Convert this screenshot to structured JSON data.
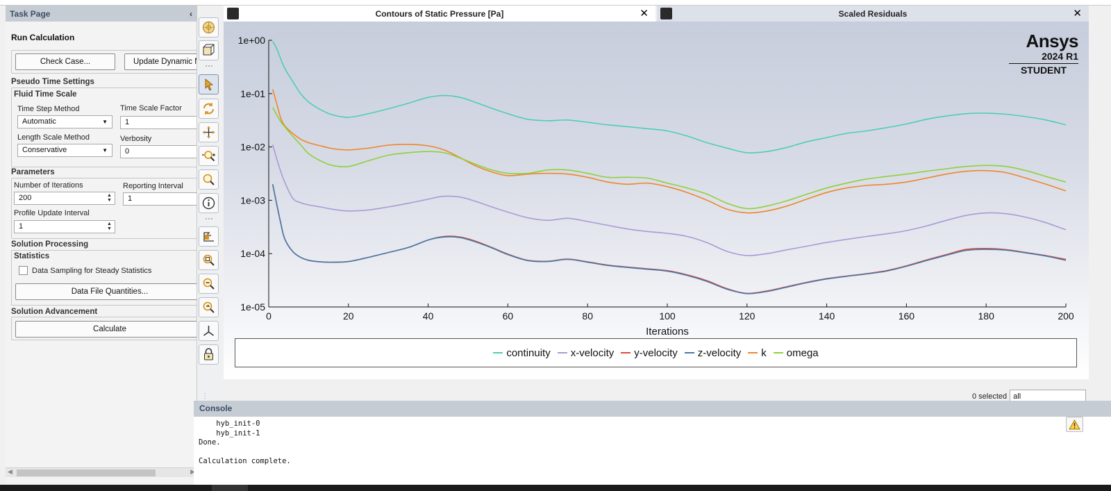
{
  "task_page": {
    "header": "Task Page",
    "collapse_glyph": "‹",
    "title": "Run Calculation",
    "check_case_label": "Check Case...",
    "update_dynamic_label": "Update Dynamic Mesh...",
    "pseudo_time_settings": "Pseudo Time Settings",
    "fluid_time_scale": "Fluid Time Scale",
    "time_step_method_label": "Time Step Method",
    "time_step_method_value": "Automatic",
    "time_scale_factor_label": "Time Scale Factor",
    "time_scale_factor_value": "1",
    "length_scale_method_label": "Length Scale Method",
    "length_scale_method_value": "Conservative",
    "verbosity_label": "Verbosity",
    "verbosity_value": "0",
    "parameters": "Parameters",
    "num_iterations_label": "Number of Iterations",
    "num_iterations_value": "200",
    "reporting_interval_label": "Reporting Interval",
    "reporting_interval_value": "1",
    "profile_update_label": "Profile Update Interval",
    "profile_update_value": "1",
    "solution_processing": "Solution Processing",
    "statistics": "Statistics",
    "data_sampling_label": "Data Sampling for Steady Statistics",
    "data_file_quantities_label": "Data File Quantities...",
    "solution_advancement": "Solution Advancement",
    "calculate_label": "Calculate"
  },
  "tabs": {
    "contours_title": "Contours of Static Pressure [Pa]",
    "residuals_title": "Scaled Residuals",
    "close_glyph": "✕"
  },
  "logo": {
    "name": "Ansys",
    "version": "2024 R1",
    "edition": "STUDENT"
  },
  "status": {
    "selected_count": "0 selected",
    "filter_value": "all"
  },
  "console": {
    "header": "Console",
    "text": "    hyb_init-0\n    hyb_init-1\nDone.\n\nCalculation complete."
  },
  "colors": {
    "continuity": "#4ecdb6",
    "x-velocity": "#a99ad6",
    "y-velocity": "#e0493a",
    "z-velocity": "#4478a8",
    "k": "#f0852a",
    "omega": "#8fd03a"
  },
  "chart_data": {
    "type": "line",
    "title": "",
    "xlabel": "Iterations",
    "ylabel": "",
    "xlim": [
      0,
      200
    ],
    "ylim": [
      1e-05,
      1
    ],
    "yscale": "log",
    "x_ticks": [
      "0",
      "20",
      "40",
      "60",
      "80",
      "100",
      "120",
      "140",
      "160",
      "180",
      "200"
    ],
    "y_ticks": [
      "1e+00",
      "1e-01",
      "1e-02",
      "1e-03",
      "1e-04",
      "1e-05"
    ],
    "legend_position": "bottom",
    "x": [
      1,
      2,
      3,
      4,
      6,
      8,
      10,
      13,
      16,
      20,
      25,
      30,
      35,
      40,
      44,
      48,
      52,
      56,
      60,
      65,
      70,
      75,
      80,
      85,
      90,
      95,
      100,
      105,
      110,
      115,
      120,
      125,
      130,
      135,
      140,
      145,
      150,
      155,
      160,
      165,
      170,
      175,
      180,
      185,
      190,
      195,
      200
    ],
    "series": [
      {
        "name": "continuity",
        "values": [
          0.95,
          0.7,
          0.45,
          0.3,
          0.17,
          0.1,
          0.07,
          0.05,
          0.04,
          0.036,
          0.042,
          0.052,
          0.066,
          0.085,
          0.092,
          0.085,
          0.068,
          0.053,
          0.042,
          0.033,
          0.031,
          0.032,
          0.029,
          0.026,
          0.024,
          0.022,
          0.02,
          0.016,
          0.012,
          0.0095,
          0.0078,
          0.0082,
          0.0098,
          0.0125,
          0.015,
          0.018,
          0.02,
          0.023,
          0.027,
          0.033,
          0.038,
          0.042,
          0.043,
          0.041,
          0.037,
          0.032,
          0.026
        ]
      },
      {
        "name": "x-velocity",
        "values": [
          0.011,
          0.006,
          0.0035,
          0.0022,
          0.0011,
          0.0009,
          0.00082,
          0.00075,
          0.00068,
          0.00063,
          0.00066,
          0.00075,
          0.00088,
          0.00105,
          0.00119,
          0.00115,
          0.00095,
          0.00075,
          0.0006,
          0.00047,
          0.00042,
          0.00046,
          0.0004,
          0.00034,
          0.00029,
          0.00026,
          0.00024,
          0.00021,
          0.00016,
          0.00011,
          9.2e-05,
          0.0001,
          0.000118,
          0.000138,
          0.000162,
          0.000185,
          0.00021,
          0.000235,
          0.00027,
          0.00033,
          0.00042,
          0.00052,
          0.00058,
          0.00056,
          0.00048,
          0.00038,
          0.00028
        ]
      },
      {
        "name": "y-velocity",
        "values": [
          0.002,
          0.00085,
          0.00038,
          0.00019,
          0.00011,
          8.5e-05,
          7.5e-05,
          7e-05,
          6.9e-05,
          7.1e-05,
          8.5e-05,
          0.000105,
          0.00013,
          0.00018,
          0.00021,
          0.000205,
          0.00017,
          0.00013,
          9.8e-05,
          7.5e-05,
          7.2e-05,
          7.9e-05,
          7e-05,
          6.1e-05,
          5.6e-05,
          5.2e-05,
          4.8e-05,
          4e-05,
          3.1e-05,
          2.2e-05,
          1.8e-05,
          2e-05,
          2.4e-05,
          2.9e-05,
          3.4e-05,
          3.8e-05,
          4.2e-05,
          4.8e-05,
          5.9e-05,
          7.6e-05,
          9.6e-05,
          0.00012,
          0.000125,
          0.000119,
          0.000105,
          9.2e-05,
          7.8e-05
        ]
      },
      {
        "name": "z-velocity",
        "values": [
          0.002,
          0.00085,
          0.00038,
          0.00019,
          0.00011,
          8.5e-05,
          7.5e-05,
          7e-05,
          6.9e-05,
          7.1e-05,
          8.5e-05,
          0.000105,
          0.00013,
          0.00018,
          0.000205,
          0.0002,
          0.000165,
          0.000128,
          9.6e-05,
          7.4e-05,
          7.1e-05,
          7.8e-05,
          6.9e-05,
          6e-05,
          5.5e-05,
          5.1e-05,
          4.7e-05,
          3.9e-05,
          3e-05,
          2.15e-05,
          1.78e-05,
          1.95e-05,
          2.35e-05,
          2.85e-05,
          3.35e-05,
          3.75e-05,
          4.15e-05,
          4.7e-05,
          5.8e-05,
          7.4e-05,
          9.3e-05,
          0.000115,
          0.00012,
          0.000116,
          0.000103,
          9e-05,
          7.5e-05
        ]
      },
      {
        "name": "k",
        "values": [
          0.12,
          0.065,
          0.035,
          0.025,
          0.018,
          0.014,
          0.012,
          0.0105,
          0.0093,
          0.0088,
          0.0095,
          0.0108,
          0.0112,
          0.0105,
          0.0088,
          0.0063,
          0.0044,
          0.0034,
          0.0029,
          0.0031,
          0.0032,
          0.0031,
          0.0027,
          0.0022,
          0.002,
          0.0021,
          0.0018,
          0.0014,
          0.001,
          0.00068,
          0.00058,
          0.00063,
          0.00078,
          0.00105,
          0.0014,
          0.0017,
          0.0019,
          0.002,
          0.0022,
          0.0026,
          0.0031,
          0.0035,
          0.0036,
          0.0033,
          0.0026,
          0.002,
          0.0015
        ]
      },
      {
        "name": "omega",
        "values": [
          0.055,
          0.04,
          0.03,
          0.024,
          0.016,
          0.011,
          0.0075,
          0.0055,
          0.0045,
          0.0043,
          0.0055,
          0.007,
          0.0078,
          0.0082,
          0.0078,
          0.0062,
          0.0047,
          0.0037,
          0.0032,
          0.0032,
          0.0037,
          0.0037,
          0.0032,
          0.0027,
          0.0027,
          0.0026,
          0.0021,
          0.0017,
          0.0013,
          0.00088,
          0.0007,
          0.00078,
          0.00098,
          0.0013,
          0.0017,
          0.0021,
          0.0025,
          0.0028,
          0.0031,
          0.0035,
          0.0039,
          0.0043,
          0.0045,
          0.0043,
          0.0036,
          0.0028,
          0.0022
        ]
      }
    ]
  }
}
